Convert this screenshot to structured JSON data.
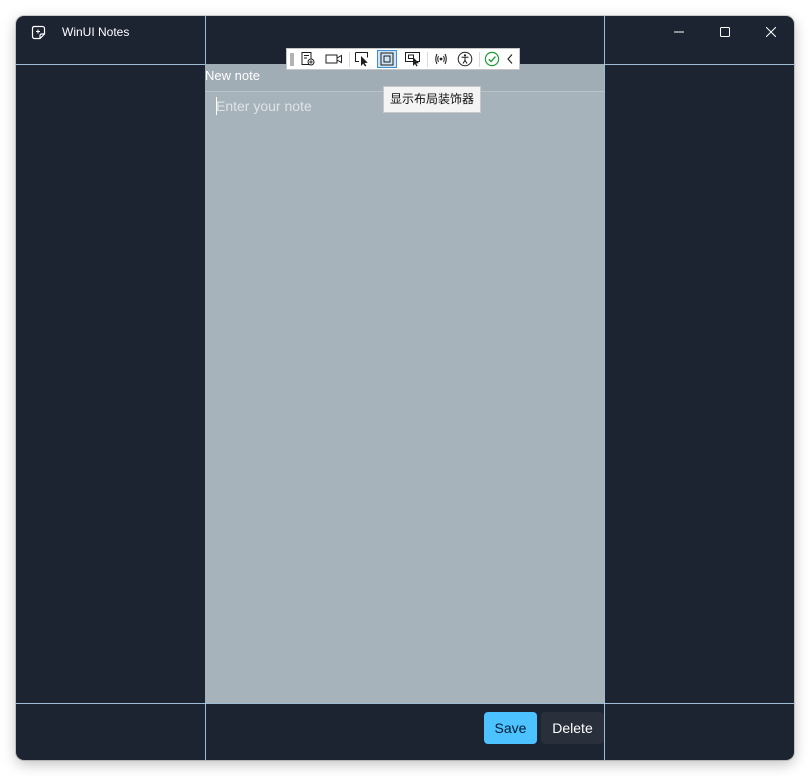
{
  "window": {
    "title": "WinUI Notes",
    "app_icon": "sticky-note-icon",
    "caption_buttons": [
      "minimize-icon",
      "maximize-icon",
      "close-icon"
    ]
  },
  "debug_toolbar": {
    "tools": [
      "live-visual-tree-icon",
      "video-icon",
      "select-element-icon",
      "layout-adorner-icon",
      "track-focus-icon",
      "binding-failures-icon",
      "accessibility-icon",
      "ok-check-icon",
      "collapse-chevron-icon"
    ],
    "active_tool": "layout-adorner-icon",
    "tooltip": "显示布局装饰器"
  },
  "note": {
    "header": "New note",
    "placeholder": "Enter your note",
    "value": ""
  },
  "actions": {
    "save_label": "Save",
    "delete_label": "Delete"
  },
  "colors": {
    "window_background": "#1c2331",
    "panel_background": "#a7b3ba",
    "accent": "#4cc2ff",
    "guide_line": "#b6d5f0"
  }
}
